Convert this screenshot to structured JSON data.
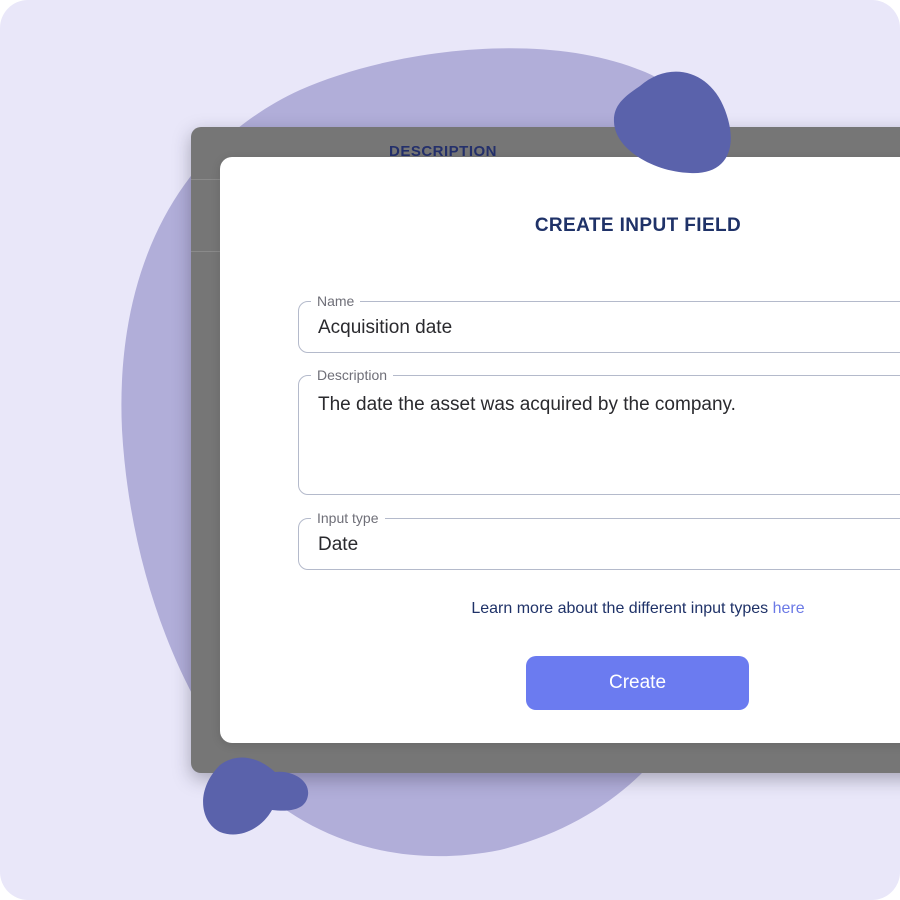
{
  "back_window": {
    "column_header": "DESCRIPTION"
  },
  "modal": {
    "title": "CREATE INPUT FIELD",
    "fields": {
      "name": {
        "label": "Name",
        "value": "Acquisition date"
      },
      "description": {
        "label": "Description",
        "value": "The date the asset was acquired by the company."
      },
      "input_type": {
        "label": "Input type",
        "value": "Date"
      }
    },
    "learn_more": {
      "text": "Learn more about the different input types ",
      "link": "here"
    },
    "create_label": "Create"
  },
  "colors": {
    "background": "#e9e7f9",
    "large_blob": "#b1aed9",
    "small_blob": "#5a62ab",
    "back_window": "#767676",
    "title_text": "#1f3268",
    "primary_button": "#6b7bf0",
    "link": "#6b79e6"
  }
}
